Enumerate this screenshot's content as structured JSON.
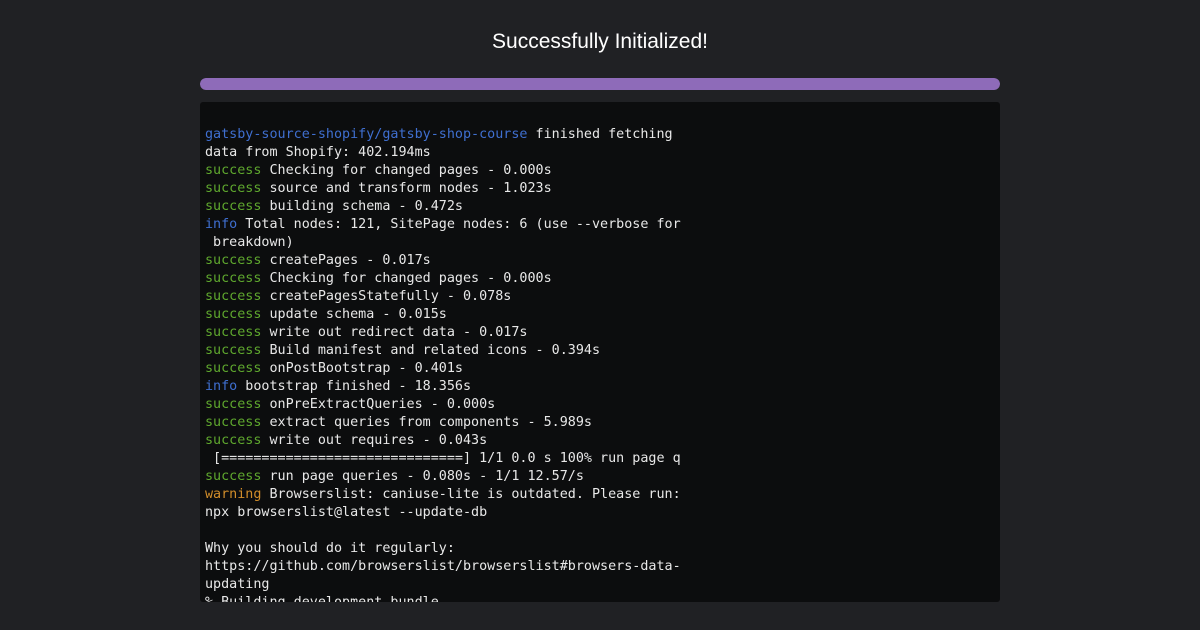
{
  "title": "Successfully Initialized!",
  "progress": {
    "percent": 100,
    "color": "#8e6bb9"
  },
  "colors": {
    "background": "#202124",
    "terminal_background": "#0c0d0e",
    "success": "#5fa82e",
    "info": "#3f6fd0",
    "warning": "#d18d2a",
    "text": "#e8e8e8"
  },
  "log_lines": [
    {
      "prefix": "gatsby-source-shopify/gatsby-shop-course",
      "level": "plugin",
      "text": " finished fetching"
    },
    {
      "prefix": "",
      "level": "",
      "text": "data from Shopify: 402.194ms"
    },
    {
      "prefix": "success",
      "level": "success",
      "text": " Checking for changed pages - 0.000s"
    },
    {
      "prefix": "success",
      "level": "success",
      "text": " source and transform nodes - 1.023s"
    },
    {
      "prefix": "success",
      "level": "success",
      "text": " building schema - 0.472s"
    },
    {
      "prefix": "info",
      "level": "info",
      "text": " Total nodes: 121, SitePage nodes: 6 (use --verbose for"
    },
    {
      "prefix": "",
      "level": "",
      "text": " breakdown)"
    },
    {
      "prefix": "success",
      "level": "success",
      "text": " createPages - 0.017s"
    },
    {
      "prefix": "success",
      "level": "success",
      "text": " Checking for changed pages - 0.000s"
    },
    {
      "prefix": "success",
      "level": "success",
      "text": " createPagesStatefully - 0.078s"
    },
    {
      "prefix": "success",
      "level": "success",
      "text": " update schema - 0.015s"
    },
    {
      "prefix": "success",
      "level": "success",
      "text": " write out redirect data - 0.017s"
    },
    {
      "prefix": "success",
      "level": "success",
      "text": " Build manifest and related icons - 0.394s"
    },
    {
      "prefix": "success",
      "level": "success",
      "text": " onPostBootstrap - 0.401s"
    },
    {
      "prefix": "info",
      "level": "info",
      "text": " bootstrap finished - 18.356s"
    },
    {
      "prefix": "success",
      "level": "success",
      "text": " onPreExtractQueries - 0.000s"
    },
    {
      "prefix": "success",
      "level": "success",
      "text": " extract queries from components - 5.989s"
    },
    {
      "prefix": "success",
      "level": "success",
      "text": " write out requires - 0.043s"
    },
    {
      "prefix": "",
      "level": "",
      "text": " [==============================] 1/1 0.0 s 100% run page q"
    },
    {
      "prefix": "success",
      "level": "success",
      "text": " run page queries - 0.080s - 1/1 12.57/s"
    },
    {
      "prefix": "warning",
      "level": "warning",
      "text": " Browserslist: caniuse-lite is outdated. Please run:"
    },
    {
      "prefix": "",
      "level": "",
      "text": "npx browserslist@latest --update-db"
    },
    {
      "prefix": "",
      "level": "",
      "text": ""
    },
    {
      "prefix": "",
      "level": "",
      "text": "Why you should do it regularly:"
    },
    {
      "prefix": "",
      "level": "",
      "text": "https://github.com/browserslist/browserslist#browsers-data-"
    },
    {
      "prefix": "",
      "level": "",
      "text": "updating"
    },
    {
      "prefix": "",
      "level": "",
      "text": "% Building development bundle"
    }
  ]
}
